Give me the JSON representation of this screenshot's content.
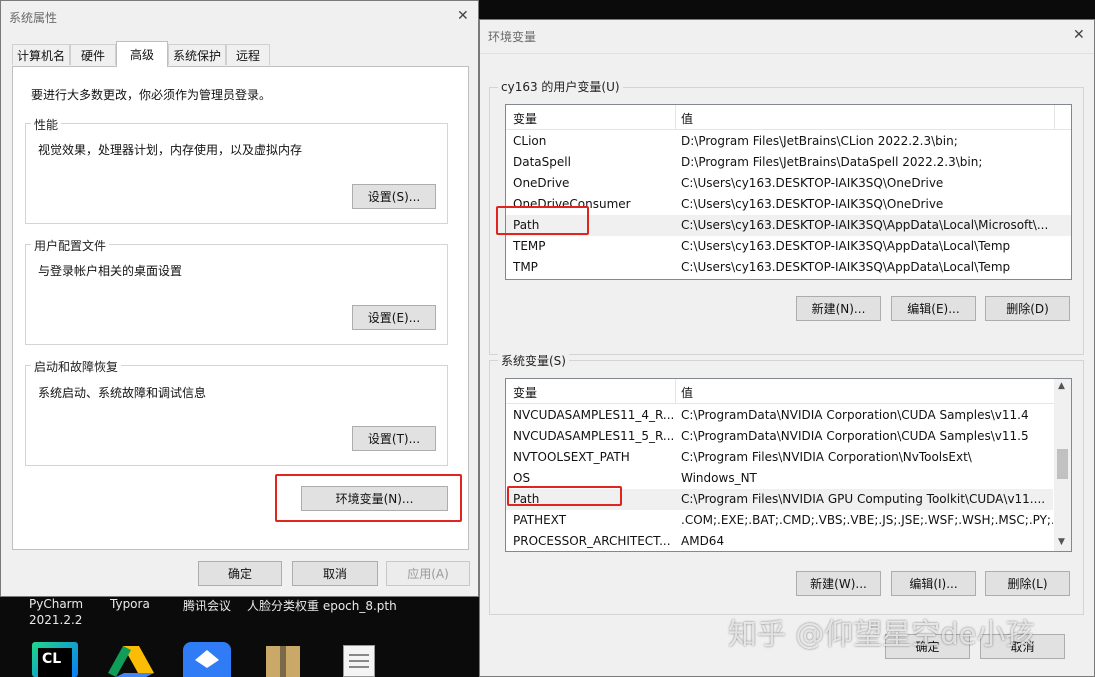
{
  "left_window": {
    "title": "系统属性",
    "tabs": [
      "计算机名",
      "硬件",
      "高级",
      "系统保护",
      "远程"
    ],
    "admin_note": "要进行大多数更改，你必须作为管理员登录。",
    "performance": {
      "label": "性能",
      "desc": "视觉效果，处理器计划，内存使用，以及虚拟内存",
      "button": "设置(S)..."
    },
    "profile": {
      "label": "用户配置文件",
      "desc": "与登录帐户相关的桌面设置",
      "button": "设置(E)..."
    },
    "startup": {
      "label": "启动和故障恢复",
      "desc": "系统启动、系统故障和调试信息",
      "button": "设置(T)..."
    },
    "env_button": "环境变量(N)...",
    "ok": "确定",
    "cancel": "取消",
    "apply": "应用(A)"
  },
  "right_window": {
    "title": "环境变量",
    "user_group": "cy163 的用户变量(U)",
    "col_var": "变量",
    "col_val": "值",
    "user_vars": [
      {
        "name": "CLion",
        "value": "D:\\Program Files\\JetBrains\\CLion 2022.2.3\\bin;"
      },
      {
        "name": "DataSpell",
        "value": "D:\\Program Files\\JetBrains\\DataSpell 2022.2.3\\bin;"
      },
      {
        "name": "OneDrive",
        "value": "C:\\Users\\cy163.DESKTOP-IAIK3SQ\\OneDrive"
      },
      {
        "name": "OneDriveConsumer",
        "value": "C:\\Users\\cy163.DESKTOP-IAIK3SQ\\OneDrive"
      },
      {
        "name": "Path",
        "value": "C:\\Users\\cy163.DESKTOP-IAIK3SQ\\AppData\\Local\\Microsoft\\..."
      },
      {
        "name": "TEMP",
        "value": "C:\\Users\\cy163.DESKTOP-IAIK3SQ\\AppData\\Local\\Temp"
      },
      {
        "name": "TMP",
        "value": "C:\\Users\\cy163.DESKTOP-IAIK3SQ\\AppData\\Local\\Temp"
      }
    ],
    "user_buttons": {
      "new": "新建(N)...",
      "edit": "编辑(E)...",
      "delete": "删除(D)"
    },
    "sys_group": "系统变量(S)",
    "sys_vars": [
      {
        "name": "NVCUDASAMPLES11_4_R...",
        "value": "C:\\ProgramData\\NVIDIA Corporation\\CUDA Samples\\v11.4"
      },
      {
        "name": "NVCUDASAMPLES11_5_R...",
        "value": "C:\\ProgramData\\NVIDIA Corporation\\CUDA Samples\\v11.5"
      },
      {
        "name": "NVTOOLSEXT_PATH",
        "value": "C:\\Program Files\\NVIDIA Corporation\\NvToolsExt\\"
      },
      {
        "name": "OS",
        "value": "Windows_NT"
      },
      {
        "name": "Path",
        "value": "C:\\Program Files\\NVIDIA GPU Computing Toolkit\\CUDA\\v11...."
      },
      {
        "name": "PATHEXT",
        "value": ".COM;.EXE;.BAT;.CMD;.VBS;.VBE;.JS;.JSE;.WSF;.WSH;.MSC;.PY;.P..."
      },
      {
        "name": "PROCESSOR_ARCHITECT...",
        "value": "AMD64"
      }
    ],
    "sys_buttons": {
      "new": "新建(W)...",
      "edit": "编辑(I)...",
      "delete": "删除(L)"
    },
    "ok": "确定",
    "cancel": "取消"
  },
  "taskbar": {
    "labels": [
      "PyCharm",
      "2021.2.2",
      "Typora",
      "腾讯会议",
      "人脸分类权重 epoch_8.pth"
    ],
    "clion_icon_text": "CL"
  },
  "watermark": "知乎 @仰望星空de小孩",
  "colors": {
    "highlight_red": "#e0251f",
    "window_bg": "#f0f0f0"
  }
}
